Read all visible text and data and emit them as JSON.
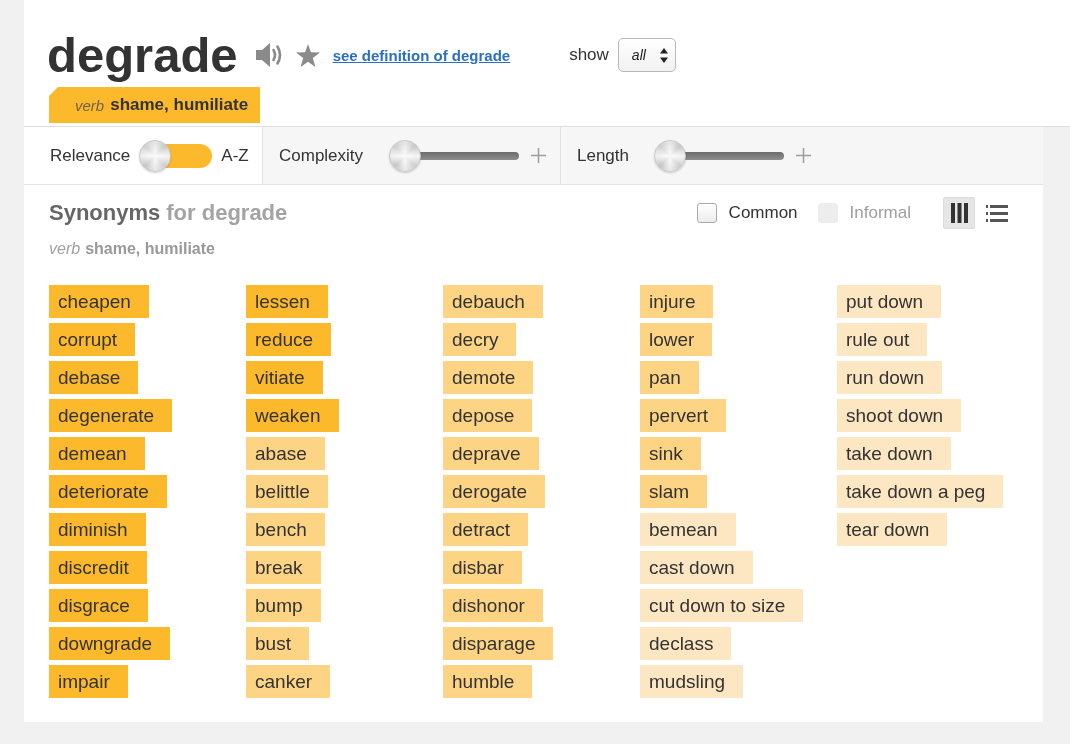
{
  "header": {
    "word": "degrade",
    "definition_link": "see definition of degrade",
    "show_label": "show",
    "show_value": "all"
  },
  "sense_tab": {
    "pos": "verb",
    "gloss": "shame, humiliate"
  },
  "toolbar": {
    "sort_switch": {
      "left_label": "Relevance",
      "right_label": "A-Z",
      "right_selected": false
    },
    "sliders": [
      {
        "label": "Complexity",
        "level": 0
      },
      {
        "label": "Length",
        "level": 0
      }
    ]
  },
  "synonyms": {
    "heading": "Synonyms",
    "heading_target": "for degrade",
    "filters": [
      {
        "label": "Common",
        "checked": false,
        "disabled": false
      },
      {
        "label": "Informal",
        "checked": false,
        "disabled": true
      }
    ],
    "views": [
      {
        "kind": "columns",
        "selected": true
      },
      {
        "kind": "list",
        "selected": false
      }
    ],
    "sense": {
      "pos": "verb",
      "gloss": "shame, humiliate"
    },
    "words": [
      {
        "text": "cheapen",
        "color": "#fdb92c"
      },
      {
        "text": "corrupt",
        "color": "#fdb92c"
      },
      {
        "text": "debase",
        "color": "#fdb92c"
      },
      {
        "text": "degenerate",
        "color": "#fdb92c"
      },
      {
        "text": "demean",
        "color": "#fdb92c"
      },
      {
        "text": "deteriorate",
        "color": "#fdb92c"
      },
      {
        "text": "diminish",
        "color": "#fdb92c"
      },
      {
        "text": "discredit",
        "color": "#fdb92c"
      },
      {
        "text": "disgrace",
        "color": "#fdb92c"
      },
      {
        "text": "downgrade",
        "color": "#fdb92c"
      },
      {
        "text": "impair",
        "color": "#fdb92c"
      },
      {
        "text": "lessen",
        "color": "#fdb92c"
      },
      {
        "text": "reduce",
        "color": "#fdb92c"
      },
      {
        "text": "vitiate",
        "color": "#fdb92c"
      },
      {
        "text": "weaken",
        "color": "#fdb92c"
      },
      {
        "text": "abase",
        "color": "#fdd384"
      },
      {
        "text": "belittle",
        "color": "#fdd384"
      },
      {
        "text": "bench",
        "color": "#fdd384"
      },
      {
        "text": "break",
        "color": "#fdd384"
      },
      {
        "text": "bump",
        "color": "#fdd384"
      },
      {
        "text": "bust",
        "color": "#fdd384"
      },
      {
        "text": "canker",
        "color": "#fdd384"
      },
      {
        "text": "debauch",
        "color": "#fdd384"
      },
      {
        "text": "decry",
        "color": "#fdd384"
      },
      {
        "text": "demote",
        "color": "#fdd384"
      },
      {
        "text": "depose",
        "color": "#fdd384"
      },
      {
        "text": "deprave",
        "color": "#fdd384"
      },
      {
        "text": "derogate",
        "color": "#fdd384"
      },
      {
        "text": "detract",
        "color": "#fdd384"
      },
      {
        "text": "disbar",
        "color": "#fdd384"
      },
      {
        "text": "dishonor",
        "color": "#fdd384"
      },
      {
        "text": "disparage",
        "color": "#fdd384"
      },
      {
        "text": "humble",
        "color": "#fdd384"
      },
      {
        "text": "injure",
        "color": "#fdd384"
      },
      {
        "text": "lower",
        "color": "#fdd384"
      },
      {
        "text": "pan",
        "color": "#fdd384"
      },
      {
        "text": "pervert",
        "color": "#fdd384"
      },
      {
        "text": "sink",
        "color": "#fdd384"
      },
      {
        "text": "slam",
        "color": "#fdd384"
      },
      {
        "text": "bemean",
        "color": "#fde6c2"
      },
      {
        "text": "cast down",
        "color": "#fde6c2"
      },
      {
        "text": "cut down to size",
        "color": "#fde6c2"
      },
      {
        "text": "declass",
        "color": "#fde6c2"
      },
      {
        "text": "mudsling",
        "color": "#fde6c2"
      },
      {
        "text": "put down",
        "color": "#fde6c2"
      },
      {
        "text": "rule out",
        "color": "#fde6c2"
      },
      {
        "text": "run down",
        "color": "#fde6c2"
      },
      {
        "text": "shoot down",
        "color": "#fde6c2"
      },
      {
        "text": "take down",
        "color": "#fde6c2"
      },
      {
        "text": "take down a peg",
        "color": "#fde6c2"
      },
      {
        "text": "tear down",
        "color": "#fde6c2"
      }
    ]
  }
}
